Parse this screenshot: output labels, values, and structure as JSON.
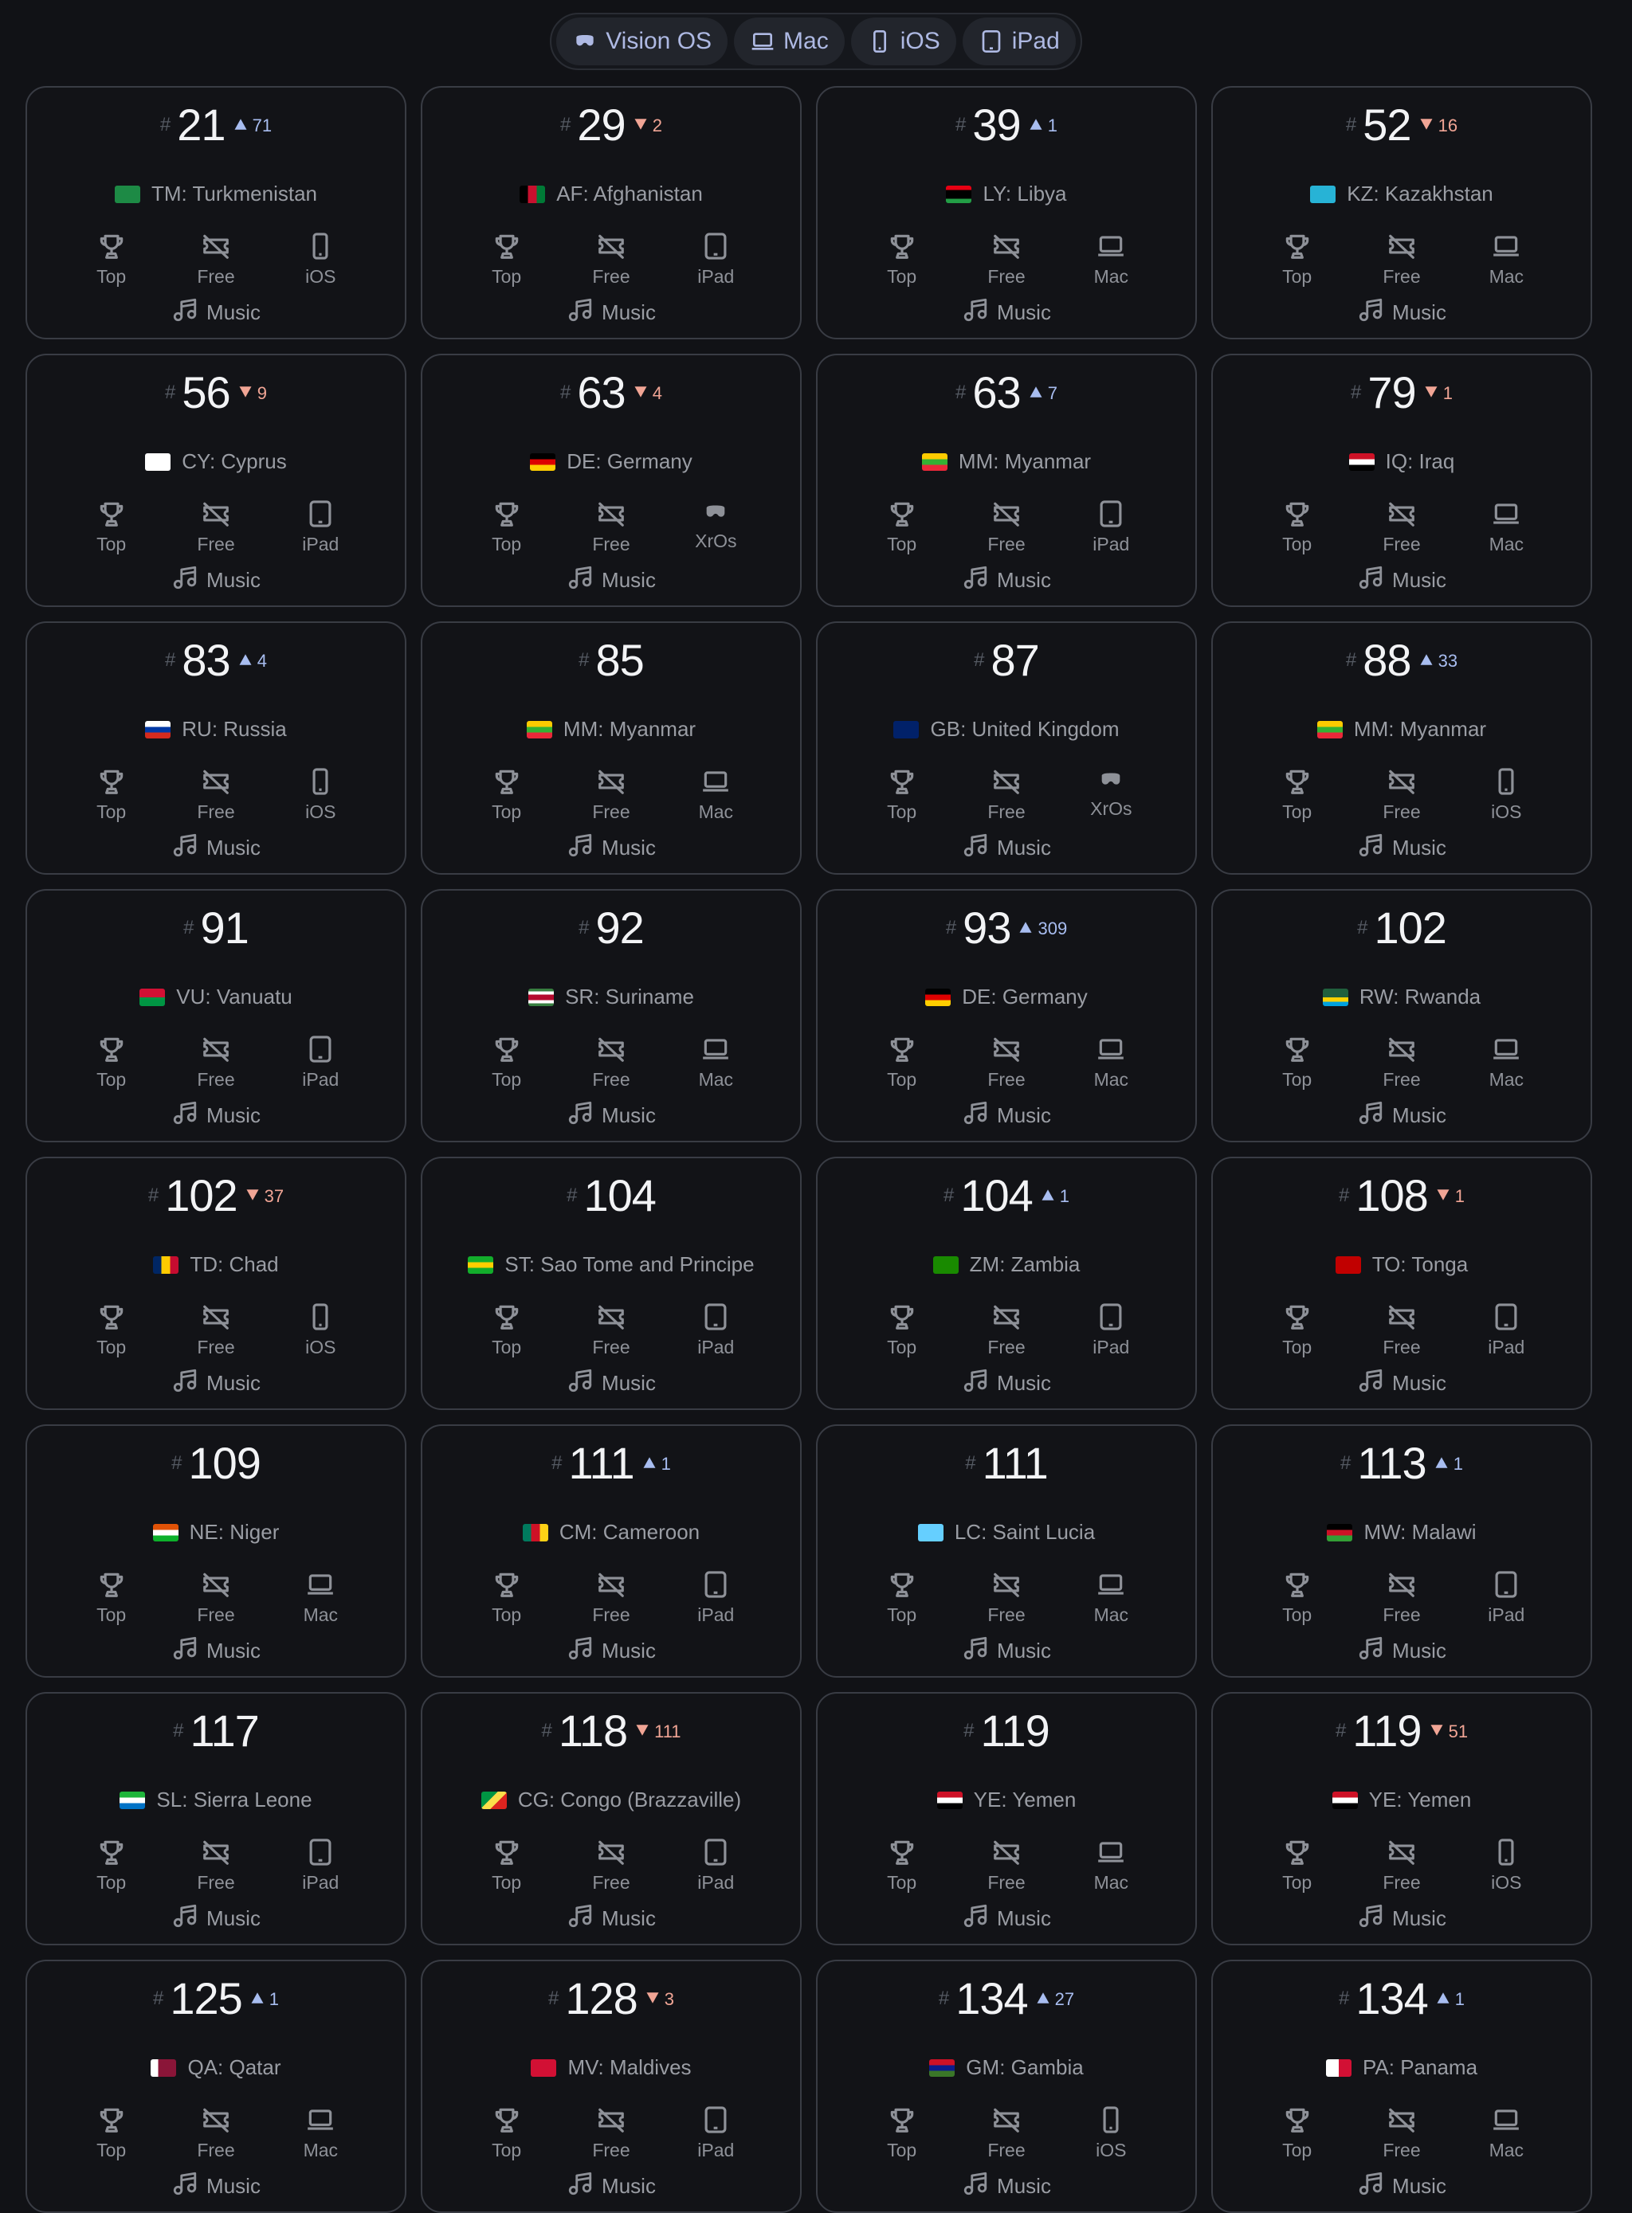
{
  "tabs": [
    {
      "label": "Vision OS",
      "icon": "vision-pro-icon"
    },
    {
      "label": "Mac",
      "icon": "laptop-icon"
    },
    {
      "label": "iOS",
      "icon": "phone-icon"
    },
    {
      "label": "iPad",
      "icon": "tablet-icon"
    }
  ],
  "labels": {
    "hash": "#",
    "top": "Top",
    "free": "Free",
    "genre": "Music"
  },
  "colors": {
    "up": "#a8bdf0",
    "down": "#f1a595"
  },
  "cards": [
    {
      "rank": "21",
      "dir": "up",
      "change": "71",
      "code": "TM",
      "country": "Turkmenistan",
      "platform": "iOS",
      "flag": "tm"
    },
    {
      "rank": "29",
      "dir": "down",
      "change": "2",
      "code": "AF",
      "country": "Afghanistan",
      "platform": "iPad",
      "flag": "af"
    },
    {
      "rank": "39",
      "dir": "up",
      "change": "1",
      "code": "LY",
      "country": "Libya",
      "platform": "Mac",
      "flag": "ly"
    },
    {
      "rank": "52",
      "dir": "down",
      "change": "16",
      "code": "KZ",
      "country": "Kazakhstan",
      "platform": "Mac",
      "flag": "kz"
    },
    {
      "rank": "56",
      "dir": "down",
      "change": "9",
      "code": "CY",
      "country": "Cyprus",
      "platform": "iPad",
      "flag": "cy"
    },
    {
      "rank": "63",
      "dir": "down",
      "change": "4",
      "code": "DE",
      "country": "Germany",
      "platform": "XrOs",
      "flag": "de"
    },
    {
      "rank": "63",
      "dir": "up",
      "change": "7",
      "code": "MM",
      "country": "Myanmar",
      "platform": "iPad",
      "flag": "mm"
    },
    {
      "rank": "79",
      "dir": "down",
      "change": "1",
      "code": "IQ",
      "country": "Iraq",
      "platform": "Mac",
      "flag": "iq"
    },
    {
      "rank": "83",
      "dir": "up",
      "change": "4",
      "code": "RU",
      "country": "Russia",
      "platform": "iOS",
      "flag": "ru"
    },
    {
      "rank": "85",
      "dir": "",
      "change": "",
      "code": "MM",
      "country": "Myanmar",
      "platform": "Mac",
      "flag": "mm"
    },
    {
      "rank": "87",
      "dir": "",
      "change": "",
      "code": "GB",
      "country": "United Kingdom",
      "platform": "XrOs",
      "flag": "gb"
    },
    {
      "rank": "88",
      "dir": "up",
      "change": "33",
      "code": "MM",
      "country": "Myanmar",
      "platform": "iOS",
      "flag": "mm"
    },
    {
      "rank": "91",
      "dir": "",
      "change": "",
      "code": "VU",
      "country": "Vanuatu",
      "platform": "iPad",
      "flag": "vu"
    },
    {
      "rank": "92",
      "dir": "",
      "change": "",
      "code": "SR",
      "country": "Suriname",
      "platform": "Mac",
      "flag": "sr"
    },
    {
      "rank": "93",
      "dir": "up",
      "change": "309",
      "code": "DE",
      "country": "Germany",
      "platform": "Mac",
      "flag": "de"
    },
    {
      "rank": "102",
      "dir": "",
      "change": "",
      "code": "RW",
      "country": "Rwanda",
      "platform": "Mac",
      "flag": "rw"
    },
    {
      "rank": "102",
      "dir": "down",
      "change": "37",
      "code": "TD",
      "country": "Chad",
      "platform": "iOS",
      "flag": "td"
    },
    {
      "rank": "104",
      "dir": "",
      "change": "",
      "code": "ST",
      "country": "Sao Tome and Principe",
      "platform": "iPad",
      "flag": "st"
    },
    {
      "rank": "104",
      "dir": "up",
      "change": "1",
      "code": "ZM",
      "country": "Zambia",
      "platform": "iPad",
      "flag": "zm"
    },
    {
      "rank": "108",
      "dir": "down",
      "change": "1",
      "code": "TO",
      "country": "Tonga",
      "platform": "iPad",
      "flag": "to"
    },
    {
      "rank": "109",
      "dir": "",
      "change": "",
      "code": "NE",
      "country": "Niger",
      "platform": "Mac",
      "flag": "ne"
    },
    {
      "rank": "111",
      "dir": "up",
      "change": "1",
      "code": "CM",
      "country": "Cameroon",
      "platform": "iPad",
      "flag": "cm"
    },
    {
      "rank": "111",
      "dir": "",
      "change": "",
      "code": "LC",
      "country": "Saint Lucia",
      "platform": "Mac",
      "flag": "lc"
    },
    {
      "rank": "113",
      "dir": "up",
      "change": "1",
      "code": "MW",
      "country": "Malawi",
      "platform": "iPad",
      "flag": "mw"
    },
    {
      "rank": "117",
      "dir": "",
      "change": "",
      "code": "SL",
      "country": "Sierra Leone",
      "platform": "iPad",
      "flag": "sl"
    },
    {
      "rank": "118",
      "dir": "down",
      "change": "111",
      "code": "CG",
      "country": "Congo (Brazzaville)",
      "platform": "iPad",
      "flag": "cg"
    },
    {
      "rank": "119",
      "dir": "",
      "change": "",
      "code": "YE",
      "country": "Yemen",
      "platform": "Mac",
      "flag": "ye"
    },
    {
      "rank": "119",
      "dir": "down",
      "change": "51",
      "code": "YE",
      "country": "Yemen",
      "platform": "iOS",
      "flag": "ye"
    },
    {
      "rank": "125",
      "dir": "up",
      "change": "1",
      "code": "QA",
      "country": "Qatar",
      "platform": "Mac",
      "flag": "qa"
    },
    {
      "rank": "128",
      "dir": "down",
      "change": "3",
      "code": "MV",
      "country": "Maldives",
      "platform": "iPad",
      "flag": "mv"
    },
    {
      "rank": "134",
      "dir": "up",
      "change": "27",
      "code": "GM",
      "country": "Gambia",
      "platform": "iOS",
      "flag": "gm"
    },
    {
      "rank": "134",
      "dir": "up",
      "change": "1",
      "code": "PA",
      "country": "Panama",
      "platform": "Mac",
      "flag": "pa"
    }
  ]
}
